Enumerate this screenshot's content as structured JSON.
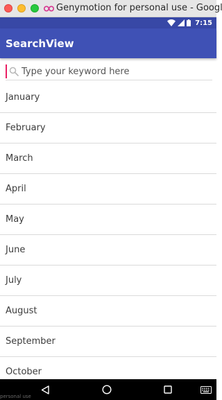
{
  "window": {
    "title": "Genymotion for personal use - Google"
  },
  "status_bar": {
    "time": "7:15",
    "icons": [
      "wifi-icon",
      "signal-icon",
      "battery-icon"
    ]
  },
  "app_bar": {
    "title": "SearchView"
  },
  "search": {
    "placeholder": "Type your keyword here",
    "value": "",
    "icon": "search-icon",
    "accent_color": "#e91e63"
  },
  "months": [
    "January",
    "February",
    "March",
    "April",
    "May",
    "June",
    "July",
    "August",
    "September",
    "October"
  ],
  "nav_bar": {
    "buttons": [
      "back-icon",
      "home-icon",
      "recents-icon",
      "keyboard-icon"
    ]
  },
  "footer": {
    "label": "personal use"
  },
  "colors": {
    "primary": "#3f51b5",
    "primary_dark": "#3848a6",
    "accent": "#e91e63"
  }
}
